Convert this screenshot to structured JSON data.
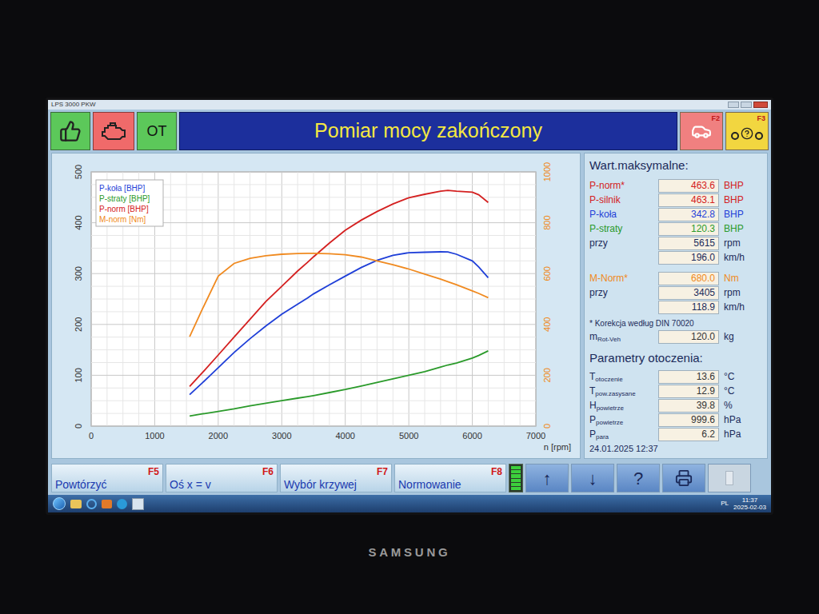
{
  "window": {
    "title": "LPS 3000 PKW"
  },
  "status": {
    "ok": {
      "color": "#5cc85a"
    },
    "engine": {
      "color": "#f06a6a"
    },
    "ot": {
      "label": "OT",
      "color": "#5cc85a"
    }
  },
  "header": {
    "title": "Pomiar mocy zakończony"
  },
  "toolbar_keys": [
    {
      "key": "F2",
      "kind": "car",
      "color": "#f08080"
    },
    {
      "key": "F3",
      "kind": "help",
      "color": "#f2d640"
    }
  ],
  "chart": {
    "legend": [
      "P-koła [BHP]",
      "P-straty [BHP]",
      "P-norm [BHP]",
      "M-norm [Nm]"
    ],
    "x_ticks": [
      "0",
      "1000",
      "2000",
      "3000",
      "4000",
      "5000",
      "6000",
      "7000"
    ],
    "x_label": "n [rpm]",
    "left_ticks": [
      "0",
      "100",
      "200",
      "300",
      "400",
      "500"
    ],
    "right_ticks": [
      "0",
      "200",
      "400",
      "600",
      "800",
      "1000"
    ],
    "rpm": [
      1550,
      1750,
      2000,
      2250,
      2500,
      2750,
      3000,
      3250,
      3405,
      3500,
      3750,
      4000,
      4250,
      4500,
      4750,
      5000,
      5250,
      5500,
      5615,
      5750,
      6000,
      6100,
      6250
    ],
    "series": [
      {
        "name": "P-koła [BHP]",
        "axis": "left",
        "color": "#1f3fd8",
        "values": [
          62,
          85,
          115,
          145,
          172,
          197,
          220,
          240,
          252,
          260,
          278,
          295,
          312,
          326,
          336,
          341,
          342,
          342.8,
          342.5,
          338,
          325,
          313,
          292
        ]
      },
      {
        "name": "P-straty [BHP]",
        "axis": "left",
        "color": "#2a9a2a",
        "values": [
          20,
          24,
          29,
          34,
          40,
          45,
          50,
          55,
          58,
          60,
          66,
          72,
          79,
          86,
          93,
          100,
          107,
          116,
          120.3,
          124,
          134,
          139,
          148
        ]
      },
      {
        "name": "P-norm [BHP]",
        "axis": "left",
        "color": "#d42020",
        "values": [
          78,
          105,
          140,
          175,
          210,
          245,
          275,
          305,
          322,
          333,
          360,
          385,
          405,
          422,
          437,
          449,
          456,
          462,
          463.6,
          462,
          460,
          455,
          440
        ]
      },
      {
        "name": "M-norm [Nm]",
        "axis": "right",
        "color": "#f08a20",
        "values": [
          352,
          460,
          590,
          640,
          660,
          670,
          676,
          679,
          680,
          680,
          678,
          674,
          665,
          650,
          635,
          618,
          598,
          578,
          568,
          556,
          532,
          522,
          505
        ]
      }
    ]
  },
  "max_values": {
    "title": "Wart.maksymalne:",
    "power_rows": [
      {
        "label": "P-norm*",
        "value": "463.6",
        "unit": "BHP",
        "color": "#d42020"
      },
      {
        "label": "P-silnik",
        "value": "463.1",
        "unit": "BHP",
        "color": "#d42020"
      },
      {
        "label": "P-koła",
        "value": "342.8",
        "unit": "BHP",
        "color": "#1f3fd8"
      },
      {
        "label": "P-straty",
        "value": "120.3",
        "unit": "BHP",
        "color": "#2a9a2a"
      },
      {
        "label": "przy",
        "value": "5615",
        "unit": "rpm",
        "color": "#1b2a5a"
      },
      {
        "label": "",
        "value": "196.0",
        "unit": "km/h",
        "color": "#1b2a5a"
      }
    ],
    "torque_rows": [
      {
        "label": "M-Norm*",
        "value": "680.0",
        "unit": "Nm",
        "color": "#f08a20"
      },
      {
        "label": "przy",
        "value": "3405",
        "unit": "rpm",
        "color": "#1b2a5a"
      },
      {
        "label": "",
        "value": "118.9",
        "unit": "km/h",
        "color": "#1b2a5a"
      }
    ],
    "note": "* Korekcja według DIN 70020",
    "mass": {
      "symbol": "m",
      "sub": "Rot-Veh",
      "value": "120.0",
      "unit": "kg"
    }
  },
  "environment": {
    "title": "Parametry otoczenia:",
    "rows": [
      {
        "symbol": "T",
        "sub": "otoczenie",
        "value": "13.6",
        "unit": "°C"
      },
      {
        "symbol": "T",
        "sub": "pow.zasysane",
        "value": "12.9",
        "unit": "°C"
      },
      {
        "symbol": "H",
        "sub": "powietrze",
        "value": "39.8",
        "unit": "%"
      },
      {
        "symbol": "P",
        "sub": "powietrze",
        "value": "999.6",
        "unit": "hPa"
      },
      {
        "symbol": "P",
        "sub": "para",
        "value": "6.2",
        "unit": "hPa"
      }
    ],
    "date": "24.01.2025 12:37"
  },
  "function_keys": [
    {
      "key": "F5",
      "label": "Powtórzyć"
    },
    {
      "key": "F6",
      "label": "Oś x = v"
    },
    {
      "key": "F7",
      "label": "Wybór krzywej"
    },
    {
      "key": "F8",
      "label": "Normowanie"
    }
  ],
  "meter": {
    "level": 1
  },
  "nav_buttons": [
    {
      "kind": "text",
      "label": "↑",
      "disabled": false
    },
    {
      "kind": "text",
      "label": "↓",
      "disabled": false
    },
    {
      "kind": "text",
      "label": "?",
      "disabled": false
    },
    {
      "kind": "print",
      "label": "",
      "disabled": false
    },
    {
      "kind": "blank",
      "label": "",
      "disabled": true
    }
  ],
  "taskbar": {
    "language": "PL",
    "time": "11:37",
    "date": "2025-02-03"
  },
  "monitor": {
    "brand": "SAMSUNG"
  }
}
